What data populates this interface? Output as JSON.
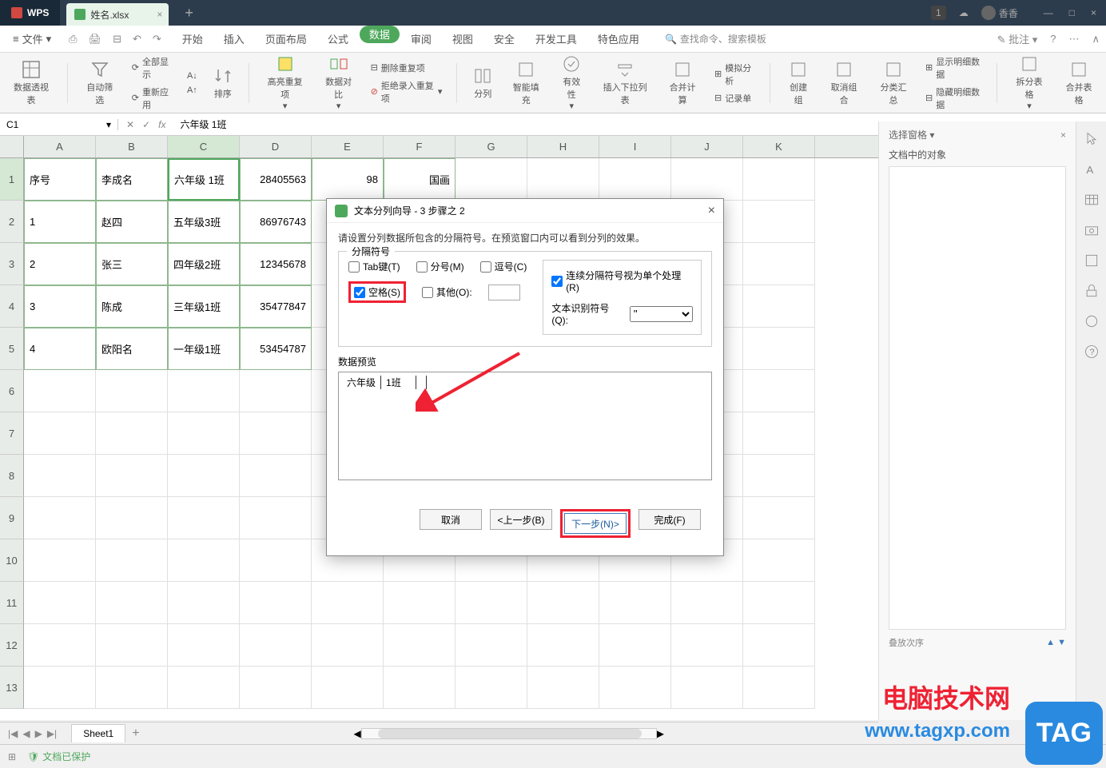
{
  "titlebar": {
    "app": "WPS",
    "doc_tab": "姓名.xlsx",
    "user": "香香",
    "badge": "1"
  },
  "menubar": {
    "file": "文件",
    "tabs": [
      "开始",
      "插入",
      "页面布局",
      "公式",
      "数据",
      "审阅",
      "视图",
      "安全",
      "开发工具",
      "特色应用"
    ],
    "active_tab": "数据",
    "search_placeholder": "查找命令、搜索模板",
    "comment": "批注"
  },
  "ribbon": {
    "pivot": "数据透视表",
    "auto_filter": "自动筛选",
    "show_all": "全部显示",
    "reapply": "重新应用",
    "sort_icon": "↓↑",
    "sort": "排序",
    "highlight_dup": "高亮重复项",
    "data_compare": "数据对比",
    "remove_dup": "删除重复项",
    "reject_dup": "拒绝录入重复项",
    "text_to_col": "分列",
    "smart_fill": "智能填充",
    "validity": "有效性",
    "dropdown": "插入下拉列表",
    "consolidate": "合并计算",
    "scenario": "模拟分析",
    "record": "记录单",
    "group": "创建组",
    "ungroup": "取消组合",
    "subtotal": "分类汇总",
    "show_detail": "显示明细数据",
    "hide_detail": "隐藏明细数据",
    "split_table": "拆分表格",
    "merge_table": "合并表格"
  },
  "formula": {
    "name_box": "C1",
    "fx": "fx",
    "value": "六年级  1班"
  },
  "columns": [
    "A",
    "B",
    "C",
    "D",
    "E",
    "F",
    "G",
    "H",
    "I",
    "J",
    "K"
  ],
  "active_col": "C",
  "rows": [
    {
      "n": "1",
      "a": "序号",
      "b": "李成名",
      "c": "六年级  1班",
      "d": "28405563",
      "e": "98",
      "f": "国画"
    },
    {
      "n": "2",
      "a": "1",
      "b": "赵四",
      "c": "五年级3班",
      "d": "86976743",
      "e": "",
      "f": ""
    },
    {
      "n": "3",
      "a": "2",
      "b": "张三",
      "c": "四年级2班",
      "d": "12345678",
      "e": "",
      "f": ""
    },
    {
      "n": "4",
      "a": "3",
      "b": "陈成",
      "c": "三年级1班",
      "d": "35477847",
      "e": "",
      "f": ""
    },
    {
      "n": "5",
      "a": "4",
      "b": "欧阳名",
      "c": "一年级1班",
      "d": "53454787",
      "e": "",
      "f": ""
    }
  ],
  "empty_rows": [
    "6",
    "7",
    "8",
    "9",
    "10",
    "11",
    "12",
    "13"
  ],
  "dialog": {
    "title": "文本分列向导 - 3 步骤之 2",
    "desc": "请设置分列数据所包含的分隔符号。在预览窗口内可以看到分列的效果。",
    "fieldset": "分隔符号",
    "tab": "Tab键(T)",
    "semicolon": "分号(M)",
    "comma": "逗号(C)",
    "space": "空格(S)",
    "other": "其他(O):",
    "consecutive": "连续分隔符号视为单个处理(R)",
    "text_qual": "文本识别符号(Q):",
    "text_qual_val": "\"",
    "preview_label": "数据预览",
    "preview_col1": "六年级",
    "preview_col2": "1班",
    "cancel": "取消",
    "back": "<上一步(B)",
    "next": "下一步(N)>",
    "finish": "完成(F)"
  },
  "right_panel": {
    "select": "选择窗格",
    "objects": "文档中的对象",
    "stack_order": "叠放次序"
  },
  "sheet": {
    "name": "Sheet1"
  },
  "statusbar": {
    "protected": "文档已保护"
  },
  "watermark": {
    "text1": "电脑技术网",
    "text2": "www.tagxp.com",
    "tag": "TAG"
  }
}
